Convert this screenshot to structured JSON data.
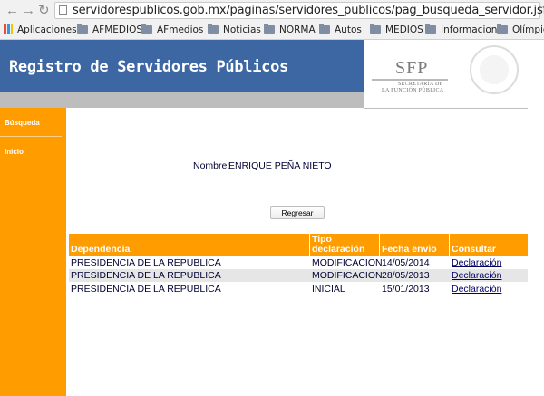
{
  "browser": {
    "url": "servidorespublicos.gob.mx/paginas/servidores_publicos/pag_busqueda_servidor.jsf",
    "bookmarks": [
      {
        "label": "Aplicaciones",
        "icon": "apps-icon"
      },
      {
        "label": "AFMEDIOS",
        "icon": "folder-icon"
      },
      {
        "label": "AFmedios",
        "icon": "folder-icon"
      },
      {
        "label": "Noticias",
        "icon": "folder-icon"
      },
      {
        "label": "NORMA",
        "icon": "folder-icon"
      },
      {
        "label": "Autos",
        "icon": "folder-icon"
      },
      {
        "label": "MEDIOS",
        "icon": "folder-icon"
      },
      {
        "label": "Informacion",
        "icon": "folder-icon"
      },
      {
        "label": "Olímpico",
        "icon": "folder-icon"
      }
    ]
  },
  "header": {
    "title": "Registro de Servidores Públicos",
    "logo": {
      "acronym": "SFP",
      "line1": "SECRETARÍA DE",
      "line2": "LA FUNCIÓN PÚBLICA"
    }
  },
  "sidebar": {
    "items": [
      {
        "label": "Búsqueda"
      },
      {
        "label": "Inicio"
      }
    ]
  },
  "main": {
    "nombre_label": "Nombre:",
    "nombre_value": "ENRIQUE PEÑA NIETO",
    "back_button": "Regresar",
    "table": {
      "headers": [
        "Dependencia",
        "Tipo declaración",
        "Fecha envio",
        "Consultar"
      ],
      "header_tipo_line1": "Tipo",
      "header_tipo_line2": "declaración",
      "rows": [
        {
          "dependencia": "PRESIDENCIA DE LA REPUBLICA",
          "tipo": "MODIFICACION",
          "fecha": "14/05/2014",
          "consultar": "Declaración"
        },
        {
          "dependencia": "PRESIDENCIA DE LA REPUBLICA",
          "tipo": "MODIFICACION",
          "fecha": "28/05/2013",
          "consultar": "Declaración"
        },
        {
          "dependencia": "PRESIDENCIA DE LA REPUBLICA",
          "tipo": "INICIAL",
          "fecha": "15/01/2013",
          "consultar": "Declaración"
        }
      ]
    }
  },
  "colors": {
    "banner": "#3d67a2",
    "accent": "#ff9c00",
    "row_alt": "#e6e6e6"
  }
}
